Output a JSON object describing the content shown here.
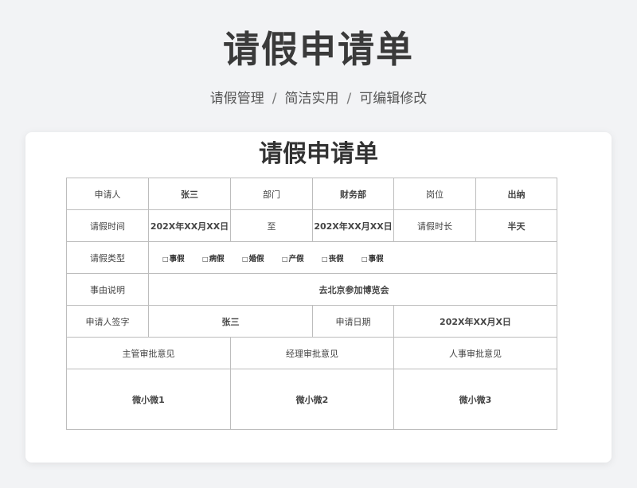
{
  "header": {
    "title": "请假申请单",
    "subtitle_parts": [
      "请假管理",
      "简洁实用",
      "可编辑修改"
    ],
    "separator": "/"
  },
  "document": {
    "title": "请假申请单",
    "row1": {
      "applicant_label": "申请人",
      "applicant_value": "张三",
      "dept_label": "部门",
      "dept_value": "财务部",
      "position_label": "岗位",
      "position_value": "出纳"
    },
    "row2": {
      "time_label": "请假时间",
      "start_value": "202X年XX月XX日",
      "to_label": "至",
      "end_value": "202X年XX月XX日",
      "duration_label": "请假时长",
      "duration_value": "半天"
    },
    "row3": {
      "type_label": "请假类型",
      "checkbox_symbol": "□",
      "types": [
        "事假",
        "病假",
        "婚假",
        "产假",
        "丧假",
        "事假"
      ]
    },
    "row4": {
      "reason_label": "事由说明",
      "reason_value": "去北京参加博览会"
    },
    "row5": {
      "sign_label": "申请人签字",
      "sign_value": "张三",
      "date_label": "申请日期",
      "date_value": "202X年XX月X日"
    },
    "row6": {
      "supervisor_label": "主管审批意见",
      "manager_label": "经理审批意见",
      "hr_label": "人事审批意见"
    },
    "row7": {
      "supervisor_value": "微小微1",
      "manager_value": "微小微2",
      "hr_value": "微小微3"
    }
  }
}
